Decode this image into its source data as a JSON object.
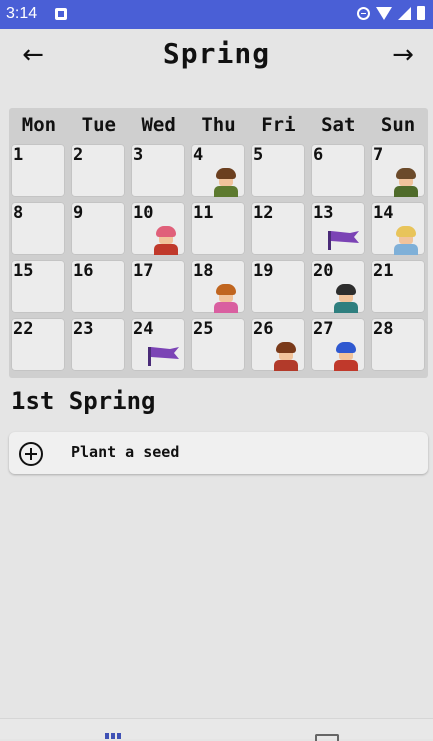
{
  "status_bar": {
    "time": "3:14"
  },
  "header": {
    "title": "Spring",
    "prev_icon": "←",
    "next_icon": "→"
  },
  "calendar": {
    "weekdays": [
      "Mon",
      "Tue",
      "Wed",
      "Thu",
      "Fri",
      "Sat",
      "Sun"
    ],
    "days": [
      {
        "day": "1"
      },
      {
        "day": "2"
      },
      {
        "day": "3"
      },
      {
        "day": "4",
        "marker": "villager-portrait-icon",
        "hair": "#6b3f1f",
        "body": "#5d7a2f"
      },
      {
        "day": "5"
      },
      {
        "day": "6"
      },
      {
        "day": "7",
        "marker": "villager-portrait-icon",
        "hair": "#6b4a2a",
        "body": "#4f6b2a"
      },
      {
        "day": "8"
      },
      {
        "day": "9"
      },
      {
        "day": "10",
        "marker": "villager-portrait-icon",
        "hair": "#e0607a",
        "body": "#c0392b"
      },
      {
        "day": "11"
      },
      {
        "day": "12"
      },
      {
        "day": "13",
        "marker": "festival-flag-icon"
      },
      {
        "day": "14",
        "marker": "villager-portrait-icon",
        "hair": "#e8c45a",
        "body": "#7fb0d8"
      },
      {
        "day": "15"
      },
      {
        "day": "16"
      },
      {
        "day": "17"
      },
      {
        "day": "18",
        "marker": "villager-portrait-icon",
        "hair": "#c0651f",
        "body": "#d95fa0"
      },
      {
        "day": "19"
      },
      {
        "day": "20",
        "marker": "villager-portrait-icon",
        "hair": "#2d2d2d",
        "body": "#2f7f7f"
      },
      {
        "day": "21"
      },
      {
        "day": "22"
      },
      {
        "day": "23"
      },
      {
        "day": "24",
        "marker": "festival-flag-icon"
      },
      {
        "day": "25"
      },
      {
        "day": "26",
        "marker": "villager-portrait-icon",
        "hair": "#7a3a1a",
        "body": "#b23a2a"
      },
      {
        "day": "27",
        "marker": "villager-portrait-icon",
        "hair": "#2f58d0",
        "body": "#c0392b"
      },
      {
        "day": "28"
      }
    ]
  },
  "selected_date": "1st Spring",
  "event": {
    "label": "Plant a seed",
    "icon": "add-circle-icon"
  },
  "bottom_nav": [
    "calendar-icon",
    "storage-icon"
  ],
  "colors": {
    "status_bar": "#4a5fd6",
    "flag": "#7b43b5",
    "bottom_nav_active": "#3f51b5"
  }
}
